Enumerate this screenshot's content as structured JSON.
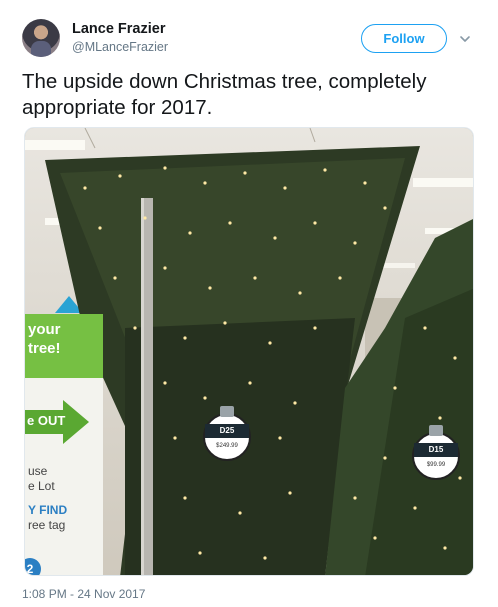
{
  "author": {
    "name": "Lance Frazier",
    "handle": "@MLanceFrazier"
  },
  "follow_label": "Follow",
  "tweet_text": "The upside down Christmas tree, completely appropriate for 2017.",
  "photo": {
    "left_tag": {
      "code": "D25",
      "price": "$249.99"
    },
    "right_tag": {
      "code": "D15",
      "price": "$99.99"
    },
    "sign": {
      "top_line1": "your",
      "top_line2": "tree!",
      "arrow_text": "e OUT",
      "line1": "use",
      "line2": "e Lot",
      "find_line": "Y FIND",
      "tag_line": "ree tag",
      "badge_number": "2"
    }
  },
  "timestamp": "1:08 PM - 24 Nov 2017",
  "colors": {
    "accent": "#1da1f2",
    "text": "#14171a",
    "muted": "#657786",
    "sign_green": "#76c043"
  },
  "icons": {
    "caret": "chevron-down-icon"
  }
}
